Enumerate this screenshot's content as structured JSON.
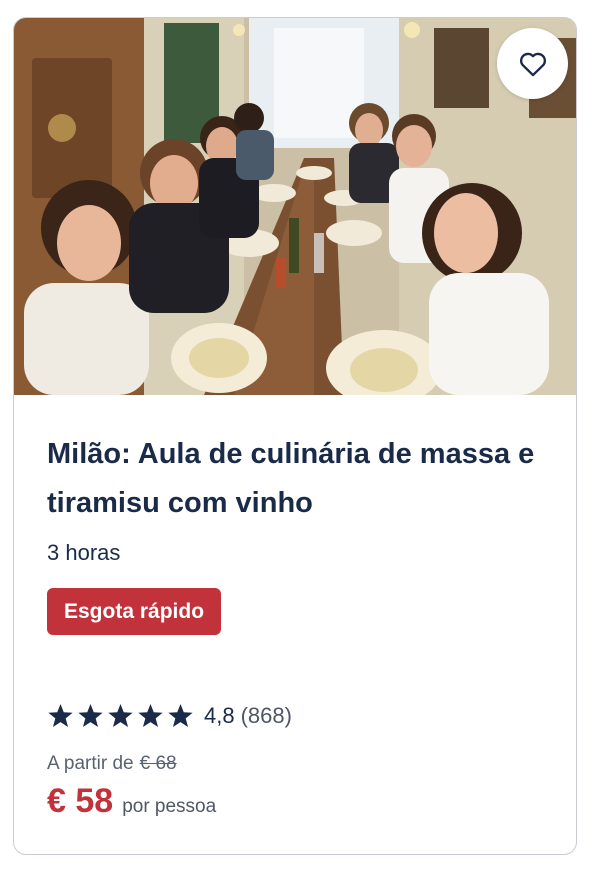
{
  "card": {
    "title": "Milão: Aula de culinária de massa e tiramisu com vinho",
    "duration": "3 horas",
    "badge": "Esgota rápido",
    "rating": {
      "value": "4,8",
      "count": "(868)",
      "stars": 5
    },
    "price": {
      "from_label": "A partir de",
      "original": "€ 68",
      "current": "€ 58",
      "per_person": "por pessoa"
    },
    "wishlist_icon": "heart-outline-icon"
  },
  "colors": {
    "title": "#1a2b49",
    "accent_red": "#c2323b",
    "star": "#1a2b49",
    "border": "#c9ccd3"
  }
}
